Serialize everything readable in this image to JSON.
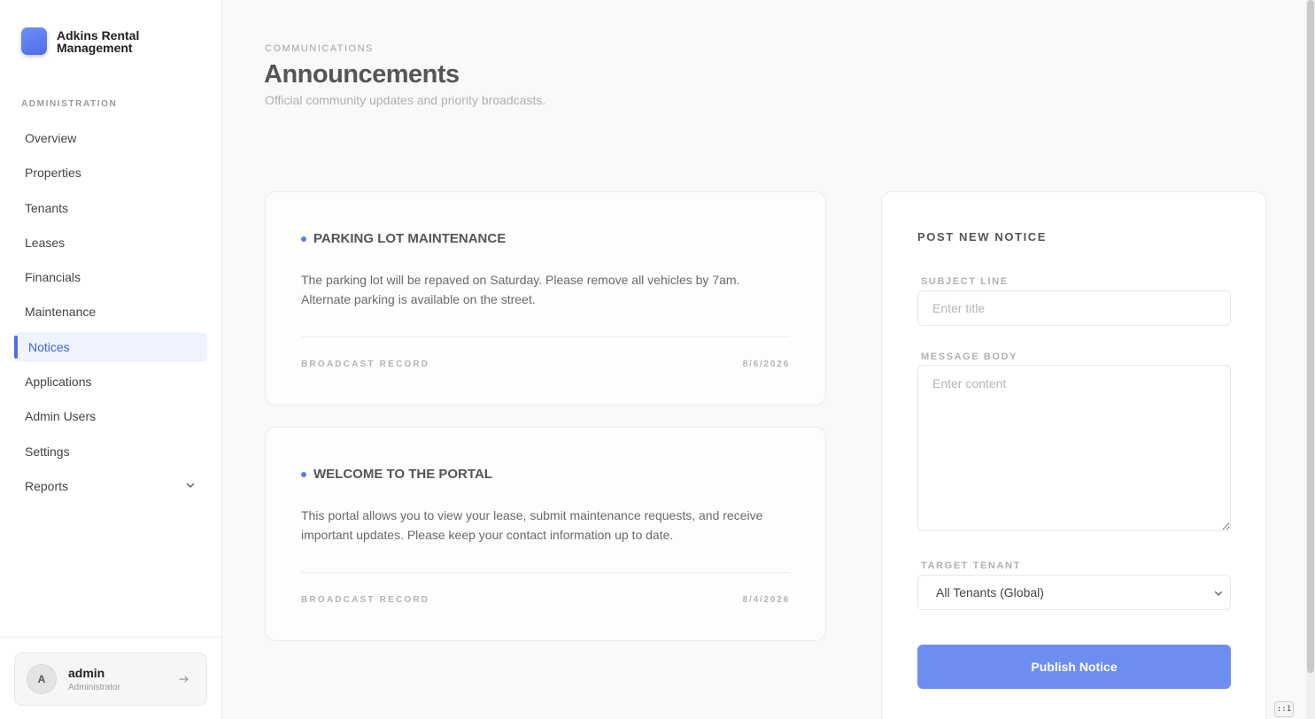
{
  "brand": {
    "name": "Adkins Rental Management"
  },
  "sidebar": {
    "section_label": "ADMINISTRATION",
    "items": [
      {
        "label": "Overview"
      },
      {
        "label": "Properties"
      },
      {
        "label": "Tenants"
      },
      {
        "label": "Leases"
      },
      {
        "label": "Financials"
      },
      {
        "label": "Maintenance"
      },
      {
        "label": "Notices",
        "active": true
      },
      {
        "label": "Applications"
      },
      {
        "label": "Admin Users"
      },
      {
        "label": "Settings"
      },
      {
        "label": "Reports",
        "icon": "chevron-down-icon"
      }
    ],
    "user": {
      "initial": "A",
      "name": "admin",
      "role": "Administrator"
    }
  },
  "header": {
    "eyebrow": "COMMUNICATIONS",
    "title": "Announcements",
    "subtitle": "Official community updates and priority broadcasts."
  },
  "announcements": [
    {
      "title": "PARKING LOT MAINTENANCE",
      "body": "The parking lot will be repaved on Saturday. Please remove all vehicles by 7am. Alternate parking is available on the street.",
      "footer_label": "BROADCAST RECORD",
      "date": "8/6/2026"
    },
    {
      "title": "WELCOME TO THE PORTAL",
      "body": "This portal allows you to view your lease, submit maintenance requests, and receive important updates. Please keep your contact information up to date.",
      "footer_label": "BROADCAST RECORD",
      "date": "8/4/2026"
    }
  ],
  "form": {
    "title": "POST NEW NOTICE",
    "subject_label": "SUBJECT LINE",
    "subject_placeholder": "Enter title",
    "body_label": "MESSAGE BODY",
    "body_placeholder": "Enter content",
    "target_label": "TARGET TENANT",
    "target_value": "All Tenants (Global)",
    "submit_label": "Publish Notice"
  },
  "corner_badge": "::1",
  "colors": {
    "accent": "#4e6ee6",
    "button": "#6d8ef0",
    "active_bg": "#eef3fe"
  }
}
